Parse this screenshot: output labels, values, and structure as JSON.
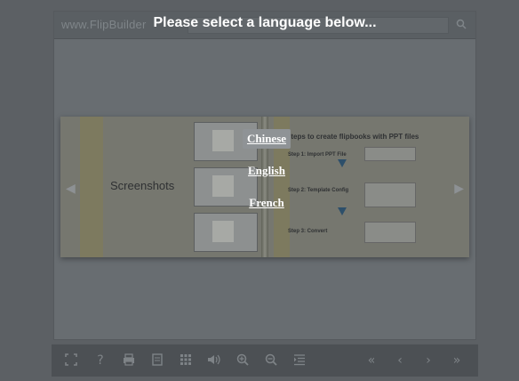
{
  "header": {
    "logo_text": "www.FlipBuilder",
    "overlay_title": "Please select a language below...",
    "search_icon": "search-icon"
  },
  "languages": [
    "Chinese",
    "English",
    "French"
  ],
  "selected_language": "Chinese",
  "book": {
    "left_page_label": "Screenshots",
    "right_page_title": "Steps to create flipbooks with PPT files",
    "steps": [
      "Step 1: Import PPT File",
      "Step 2: Template Config",
      "Step 3: Convert"
    ]
  },
  "toolbar": {
    "icons": [
      "fullscreen-icon",
      "help-icon",
      "print-icon",
      "document-icon",
      "thumbnails-icon",
      "sound-icon",
      "zoom-in-icon",
      "zoom-out-icon",
      "table-of-contents-icon",
      "first-page-icon",
      "previous-page-icon",
      "next-page-icon",
      "last-page-icon"
    ]
  },
  "colors": {
    "overlay_text": "#ffffff",
    "selected_bg": "#8f9396",
    "toolbar_bg": "#4c5054"
  }
}
